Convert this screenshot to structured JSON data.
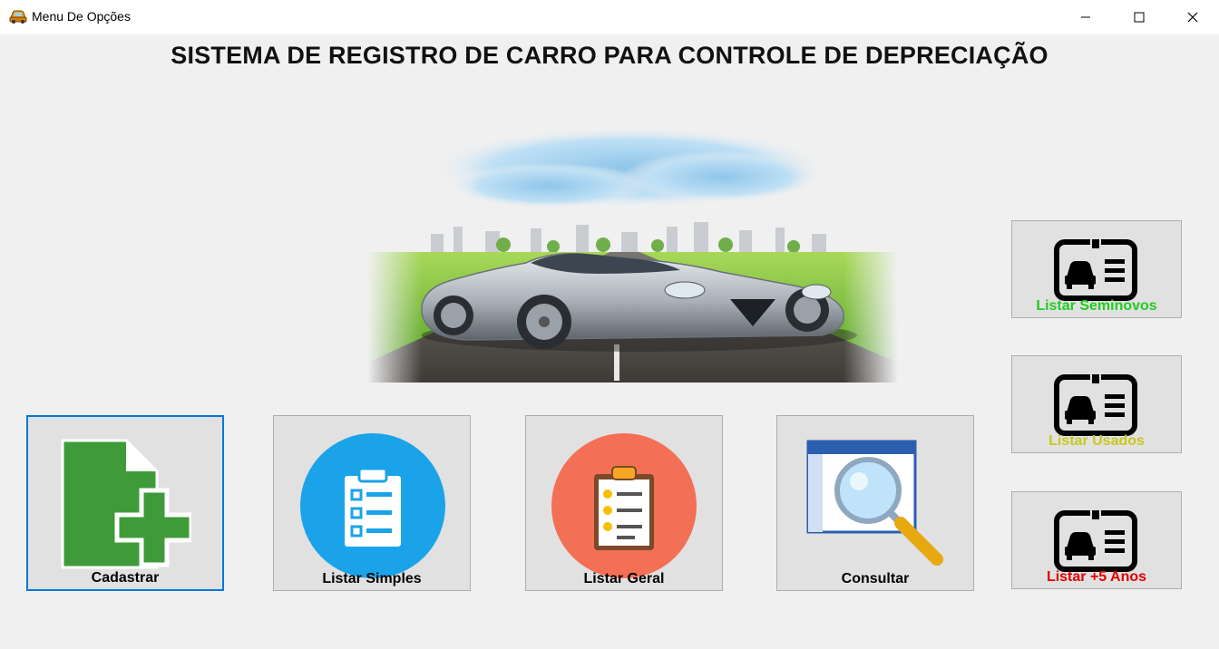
{
  "window": {
    "title": "Menu De Opções",
    "icons": [
      "car-app-icon",
      "minimize-icon",
      "maximize-icon",
      "close-icon"
    ]
  },
  "heading": "SISTEMA DE REGISTRO DE CARRO PARA CONTROLE DE DEPRECIAÇÃO",
  "buttons": {
    "cadastrar": "Cadastrar",
    "listar_simples": "Listar Simples",
    "listar_geral": "Listar Geral",
    "consultar": "Consultar",
    "listar_seminovos": "Listar Seminovos",
    "listar_usados": "Listar Usados",
    "listar_5anos": "Listar +5 Anos"
  },
  "colors": {
    "seminovos_label": "#22cc22",
    "usados_label": "#c8c820",
    "anos5_label": "#e00000",
    "focus_border": "#0078d7",
    "listar_simples_circle": "#1aa3e8",
    "listar_geral_circle": "#f36f55"
  }
}
